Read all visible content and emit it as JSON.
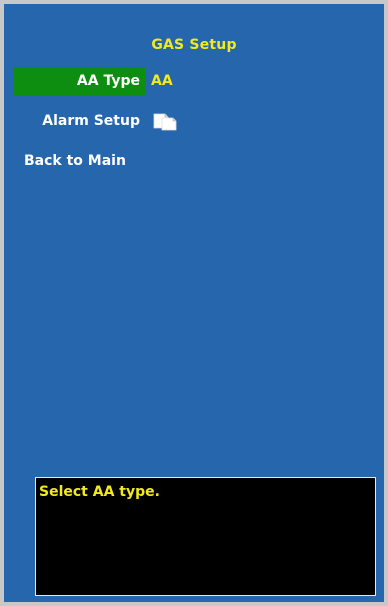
{
  "screen": {
    "title": "GAS Setup"
  },
  "menu": {
    "items": [
      {
        "label": "AA Type",
        "value": "AA",
        "selected": true
      },
      {
        "label": "Alarm Setup",
        "icon": "submenu-icon"
      },
      {
        "label": "Back to Main"
      }
    ]
  },
  "help": {
    "text": "Select AA type."
  },
  "colors": {
    "panel_background": "#2566ac",
    "highlight": "#0e8e10",
    "title_text": "#f2ea1c",
    "help_background": "#000000"
  }
}
